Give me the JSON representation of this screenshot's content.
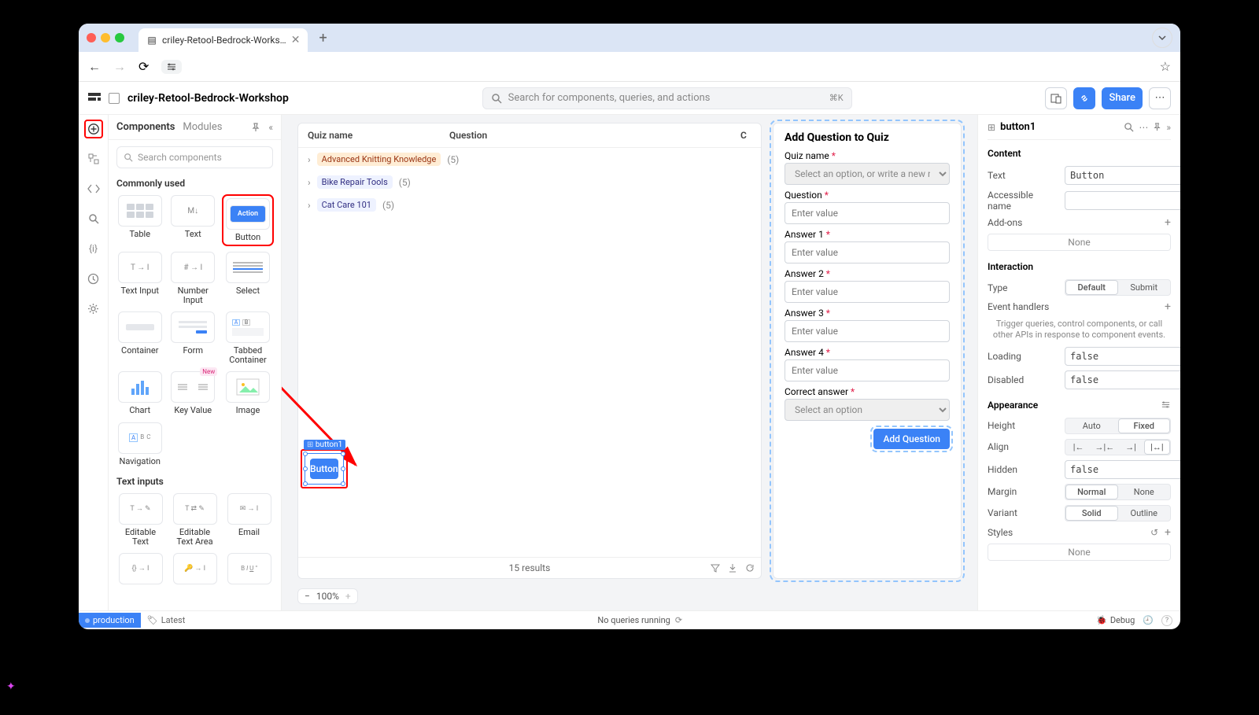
{
  "browser": {
    "tab_title": "criley-Retool-Bedrock-Works…"
  },
  "header": {
    "title": "criley-Retool-Bedrock-Workshop",
    "search_placeholder": "Search for components, queries, and actions",
    "search_kbd": "⌘K",
    "share_label": "Share"
  },
  "panel": {
    "tab_components": "Components",
    "tab_modules": "Modules",
    "search_placeholder": "Search components",
    "section_common": "Commonly used",
    "items": {
      "table": "Table",
      "text": "Text",
      "button": "Button",
      "text_input": "Text Input",
      "number_input": "Number Input",
      "select": "Select",
      "container": "Container",
      "form": "Form",
      "tabbed": "Tabbed Container",
      "chart": "Chart",
      "keyvalue": "Key Value",
      "image": "Image",
      "navigation": "Navigation"
    },
    "action_label": "Action",
    "new_badge": "New",
    "section_textinputs": "Text inputs",
    "ti": {
      "editable_text": "Editable Text",
      "editable_area": "Editable Text Area",
      "email": "Email"
    }
  },
  "canvas": {
    "table": {
      "col_quiz": "Quiz name",
      "col_question": "Question",
      "col_c": "C",
      "rows": [
        {
          "name": "Advanced Knitting Knowledge",
          "count": "(5)",
          "chip": "orange"
        },
        {
          "name": "Bike Repair Tools",
          "count": "(5)",
          "chip": "purple"
        },
        {
          "name": "Cat Care 101",
          "count": "(5)",
          "chip": "purple"
        }
      ],
      "results": "15 results"
    },
    "form": {
      "title": "Add Question to Quiz",
      "quiz_name": "Quiz name",
      "quiz_placeholder": "Select an option, or write a new name…",
      "question": "Question",
      "enter": "Enter value",
      "a1": "Answer 1",
      "a2": "Answer 2",
      "a3": "Answer 3",
      "a4": "Answer 4",
      "correct": "Correct answer",
      "correct_placeholder": "Select an option",
      "add_btn": "Add Question"
    },
    "selected": {
      "tag": "button1",
      "text": "Button"
    },
    "zoom": "100%"
  },
  "inspector": {
    "name": "button1",
    "s_content": "Content",
    "text_label": "Text",
    "text_value": "Button",
    "accessible": "Accessible name",
    "addons": "Add-ons",
    "none": "None",
    "s_interaction": "Interaction",
    "type_label": "Type",
    "type_default": "Default",
    "type_submit": "Submit",
    "eventhandlers": "Event handlers",
    "hint": "Trigger queries, control components, or call other APIs in response to component events.",
    "loading": "Loading",
    "loading_val": "false",
    "disabled": "Disabled",
    "disabled_val": "false",
    "s_appearance": "Appearance",
    "height": "Height",
    "auto": "Auto",
    "fixed": "Fixed",
    "align": "Align",
    "hidden": "Hidden",
    "hidden_val": "false",
    "margin": "Margin",
    "normal": "Normal",
    "none2": "None",
    "variant": "Variant",
    "solid": "Solid",
    "outline": "Outline",
    "styles": "Styles"
  },
  "status": {
    "env": "production",
    "latest": "Latest",
    "queries": "No queries running",
    "debug": "Debug"
  }
}
